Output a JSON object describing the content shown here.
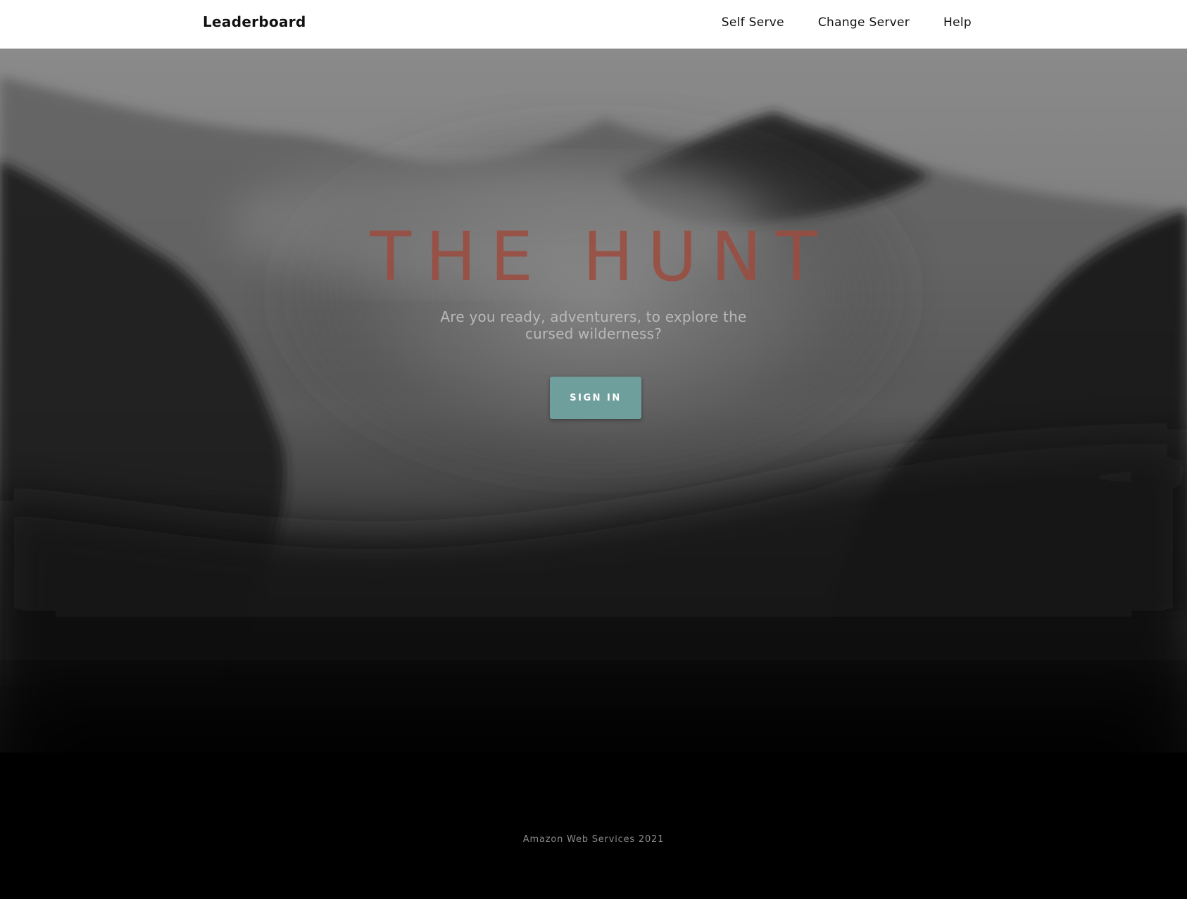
{
  "navbar": {
    "brand": "Leaderboard",
    "links": [
      {
        "label": "Self Serve"
      },
      {
        "label": "Change Server"
      },
      {
        "label": "Help"
      }
    ]
  },
  "hero": {
    "title": "THE HUNT",
    "subtitle": "Are you ready, adventurers, to explore the cursed wilderness?",
    "button_label": "SIGN IN",
    "background": "misty-forest-mountains-image"
  },
  "footer": {
    "text": "Amazon Web Services 2021"
  },
  "colors": {
    "accent": "#6f9f9c",
    "title": "#9d4c40",
    "navbar": "#ffffff",
    "text": "#111111"
  }
}
